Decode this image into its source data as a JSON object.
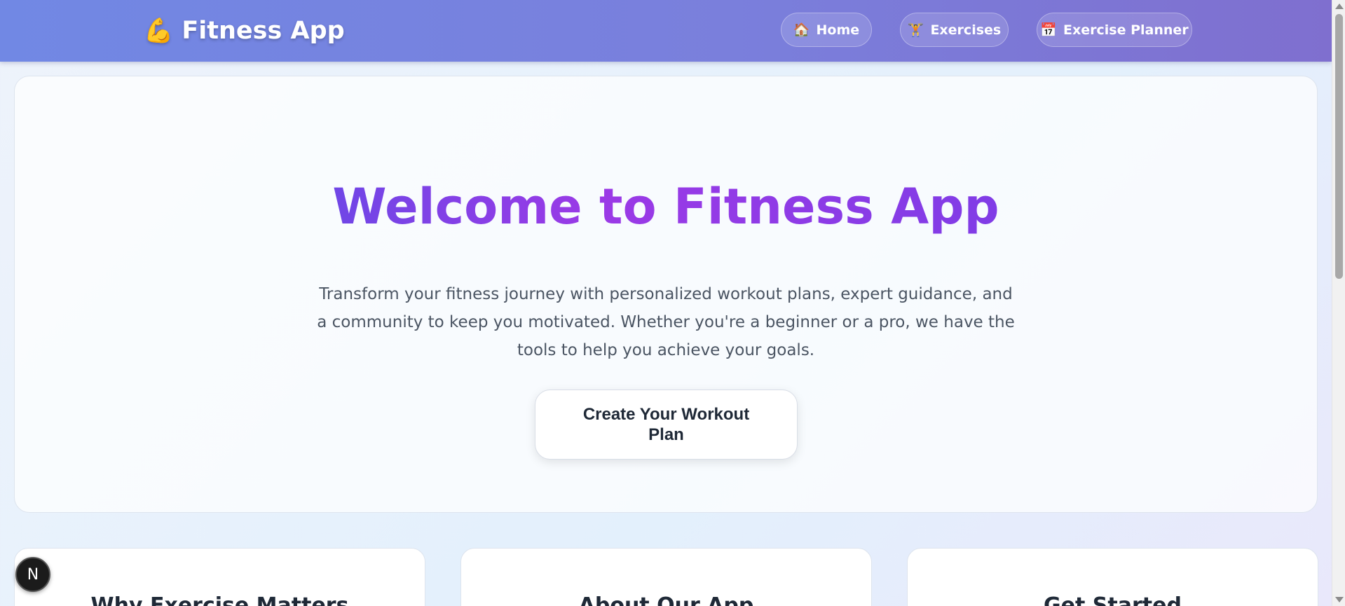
{
  "header": {
    "brand_icon": "💪",
    "brand_name": "Fitness App",
    "nav": [
      {
        "icon": "🏠",
        "label": "Home"
      },
      {
        "icon": "🏋",
        "label": "Exercises"
      },
      {
        "icon": "📅",
        "label": "Exercise Planner"
      }
    ]
  },
  "hero": {
    "title": "Welcome to Fitness App",
    "description": "Transform your fitness journey with personalized workout plans, expert guidance, and a community to keep you motivated. Whether you're a beginner or a pro, we have the tools to help you achieve your goals.",
    "cta_label": "Create Your Workout Plan"
  },
  "cards": [
    {
      "title": "Why Exercise Matters"
    },
    {
      "title": "About Our App"
    },
    {
      "title": "Get Started"
    }
  ],
  "floating_button": {
    "label": "N"
  },
  "colors": {
    "header_start": "#7188e4",
    "header_end": "#7f6fcf",
    "title_gradient_start": "#3a55e6",
    "title_gradient_mid": "#9b3ae6"
  }
}
